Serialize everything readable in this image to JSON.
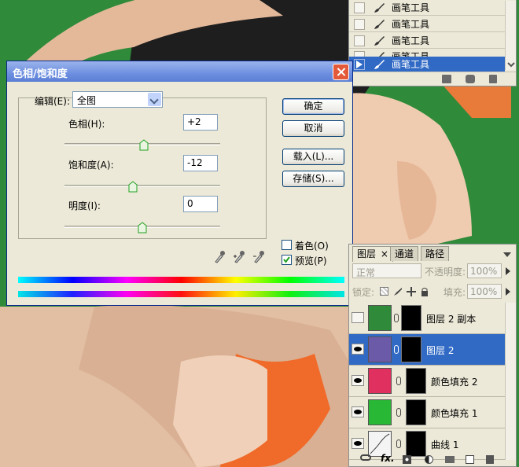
{
  "history_panel": {
    "items": [
      {
        "label": "画笔工具",
        "selected": false
      },
      {
        "label": "画笔工具",
        "selected": false
      },
      {
        "label": "画笔工具",
        "selected": false
      },
      {
        "label": "画笔工具",
        "selected": false
      },
      {
        "label": "画笔工具",
        "selected": true
      }
    ],
    "footer_icons": [
      "new-document-icon",
      "camera-icon",
      "trash-icon"
    ]
  },
  "dialog": {
    "title": "色相/饱和度",
    "edit_label": "编辑(E):",
    "edit_value": "全图",
    "hue": {
      "label": "色相(H):",
      "value": "+2",
      "level": 0.51
    },
    "saturation": {
      "label": "饱和度(A):",
      "value": "-12",
      "level": 0.44
    },
    "lightness": {
      "label": "明度(I):",
      "value": "0",
      "level": 0.5
    },
    "buttons": {
      "ok": "确定",
      "cancel": "取消",
      "load": "载入(L)...",
      "save": "存储(S)..."
    },
    "colorize": {
      "label": "着色(O)",
      "checked": false
    },
    "preview": {
      "label": "预览(P)",
      "checked": true
    }
  },
  "layers_panel": {
    "tabs": [
      "图层",
      "通道",
      "路径"
    ],
    "tab_close": "×",
    "blend_mode": "正常",
    "opacity_label": "不透明度:",
    "opacity_value": "100%",
    "lock_label": "锁定:",
    "fill_label": "填充:",
    "fill_value": "100%",
    "layers": [
      {
        "name": "图层 2 副本",
        "visible": false,
        "selected": false,
        "thumb_color": "#2f8a3a"
      },
      {
        "name": "图层 2",
        "visible": true,
        "selected": true,
        "thumb_color": "#6b5aa8"
      },
      {
        "name": "颜色填充 2",
        "visible": true,
        "selected": false,
        "thumb_color": "#e0305f"
      },
      {
        "name": "颜色填充 1",
        "visible": true,
        "selected": false,
        "thumb_color": "#29b835"
      },
      {
        "name": "曲线 1",
        "visible": true,
        "selected": false,
        "thumb_color": "#f4f4f4"
      }
    ],
    "footer": {
      "fx": "fx."
    }
  }
}
